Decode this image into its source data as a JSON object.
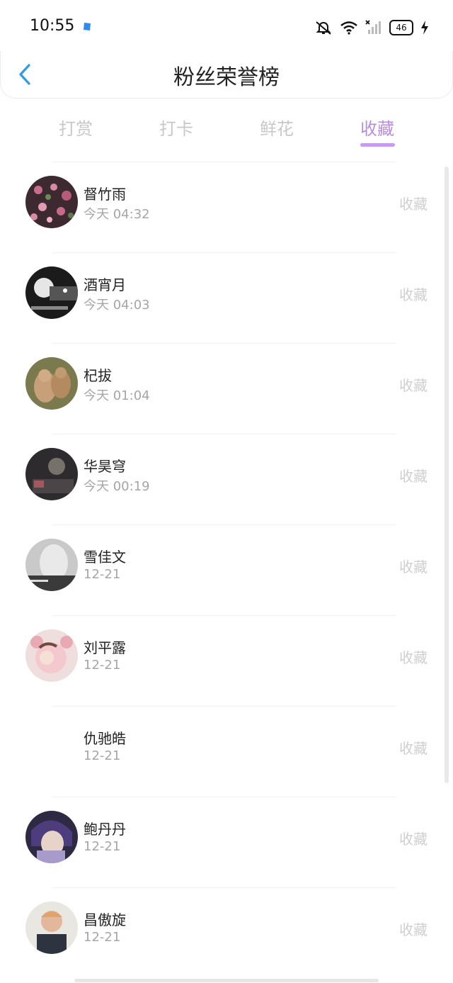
{
  "status_bar": {
    "time": "10:55",
    "battery": "46",
    "icons": [
      "app-dot-icon",
      "mute-bell-icon",
      "wifi-icon",
      "signal-icon",
      "battery-icon",
      "charging-icon"
    ]
  },
  "header": {
    "title": "粉丝荣誉榜",
    "back_icon": "chevron-left-icon"
  },
  "tabs": [
    {
      "label": "打赏",
      "active": false
    },
    {
      "label": "打卡",
      "active": false
    },
    {
      "label": "鲜花",
      "active": false
    },
    {
      "label": "收藏",
      "active": true
    }
  ],
  "colors": {
    "accent": "#b98ddf",
    "underline": "#c79bf0",
    "back_icon": "#2f9ae8"
  },
  "fans": [
    {
      "name": "督竹雨",
      "time": "今天 04:32",
      "action": "收藏",
      "avatar": "flowers"
    },
    {
      "name": "酒宵月",
      "time": "今天 04:03",
      "action": "收藏",
      "avatar": "night-bw"
    },
    {
      "name": "杞拔",
      "time": "今天 01:04",
      "action": "收藏",
      "avatar": "animals"
    },
    {
      "name": "华昊穹",
      "time": "今天 00:19",
      "action": "收藏",
      "avatar": "dark-figure"
    },
    {
      "name": "雪佳文",
      "time": "12-21",
      "action": "收藏",
      "avatar": "gray-girl"
    },
    {
      "name": "刘平露",
      "time": "12-21",
      "action": "收藏",
      "avatar": "pink-bear"
    },
    {
      "name": "仇驰皓",
      "time": "12-21",
      "action": "收藏",
      "avatar": "none"
    },
    {
      "name": "鲍丹丹",
      "time": "12-21",
      "action": "收藏",
      "avatar": "anime-purple"
    },
    {
      "name": "昌傲旋",
      "time": "12-21",
      "action": "收藏",
      "avatar": "cover-face"
    }
  ]
}
